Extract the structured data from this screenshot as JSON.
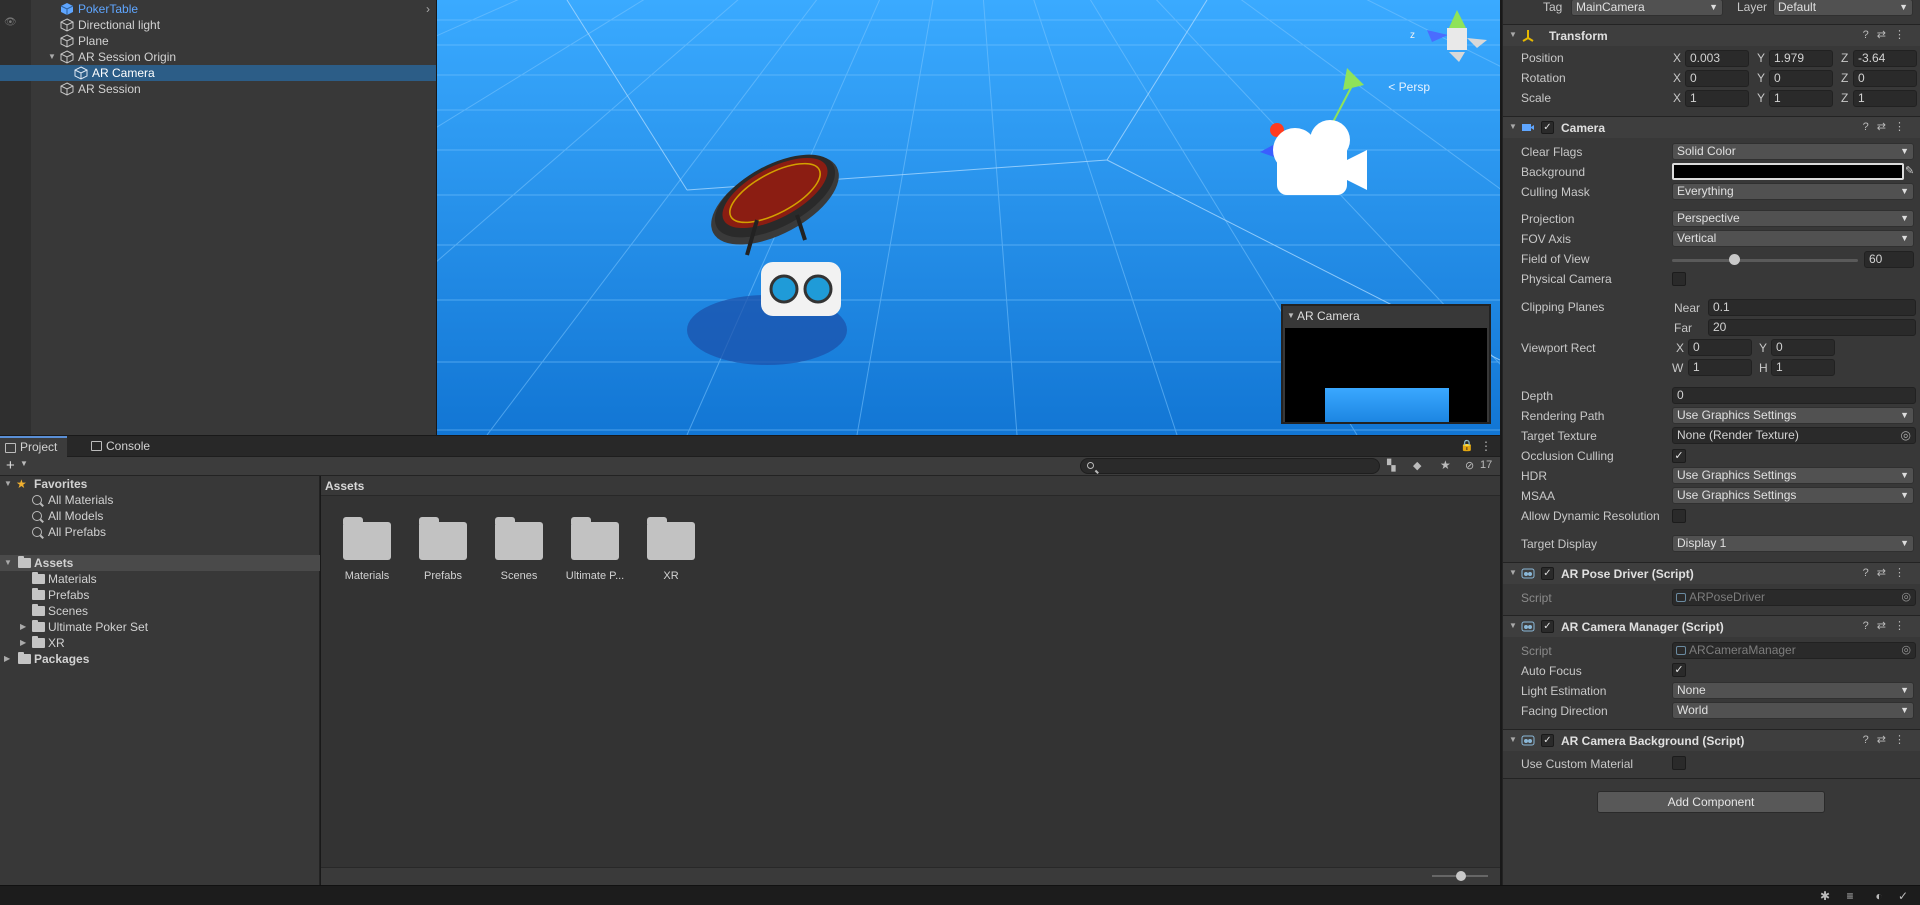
{
  "hierarchy": {
    "items": [
      {
        "label": "PokerTable",
        "prefab": true
      },
      {
        "label": "Directional light"
      },
      {
        "label": "Plane"
      },
      {
        "label": "AR Session Origin"
      },
      {
        "label": "AR Camera"
      },
      {
        "label": "AR Session"
      }
    ]
  },
  "scene": {
    "persp_label": "< Persp",
    "gizmo_z": "z",
    "camera_preview_title": "AR Camera"
  },
  "inspector": {
    "tag_label": "Tag",
    "tag_value": "MainCamera",
    "layer_label": "Layer",
    "layer_value": "Default",
    "transform": {
      "title": "Transform",
      "position_label": "Position",
      "rotation_label": "Rotation",
      "scale_label": "Scale",
      "position": {
        "x": "0.003",
        "y": "1.979",
        "z": "-3.64"
      },
      "rotation": {
        "x": "0",
        "y": "0",
        "z": "0"
      },
      "scale": {
        "x": "1",
        "y": "1",
        "z": "1"
      }
    },
    "camera": {
      "title": "Camera",
      "clear_flags_label": "Clear Flags",
      "clear_flags": "Solid Color",
      "background_label": "Background",
      "background_color": "#000000",
      "culling_mask_label": "Culling Mask",
      "culling_mask": "Everything",
      "projection_label": "Projection",
      "projection": "Perspective",
      "fov_axis_label": "FOV Axis",
      "fov_axis": "Vertical",
      "fov_label": "Field of View",
      "fov": "60",
      "physical_label": "Physical Camera",
      "clipping_label": "Clipping Planes",
      "near_label": "Near",
      "near": "0.1",
      "far_label": "Far",
      "far": "20",
      "viewport_label": "Viewport Rect",
      "vp_x": "0",
      "vp_y": "0",
      "vp_w": "1",
      "vp_h": "1",
      "depth_label": "Depth",
      "depth": "0",
      "rendering_path_label": "Rendering Path",
      "rendering_path": "Use Graphics Settings",
      "target_texture_label": "Target Texture",
      "target_texture": "None (Render Texture)",
      "occlusion_label": "Occlusion Culling",
      "hdr_label": "HDR",
      "hdr": "Use Graphics Settings",
      "msaa_label": "MSAA",
      "msaa": "Use Graphics Settings",
      "dynamic_res_label": "Allow Dynamic Resolution",
      "target_display_label": "Target Display",
      "target_display": "Display 1"
    },
    "pose_driver": {
      "title": "AR Pose Driver (Script)",
      "script_label": "Script",
      "script": "ARPoseDriver"
    },
    "camera_manager": {
      "title": "AR Camera Manager (Script)",
      "script_label": "Script",
      "script": "ARCameraManager",
      "auto_focus_label": "Auto Focus",
      "light_est_label": "Light Estimation",
      "light_est": "None",
      "facing_label": "Facing Direction",
      "facing": "World"
    },
    "camera_background": {
      "title": "AR Camera Background (Script)",
      "custom_mat_label": "Use Custom Material"
    },
    "add_component": "Add Component",
    "axis": {
      "x": "X",
      "y": "Y",
      "z": "Z",
      "w": "W",
      "h": "H"
    }
  },
  "project": {
    "tabs": [
      "Project",
      "Console"
    ],
    "hidden_count": "17",
    "favorites_label": "Favorites",
    "favorites": [
      "All Materials",
      "All Models",
      "All Prefabs"
    ],
    "assets_label": "Assets",
    "asset_folders": [
      "Materials",
      "Prefabs",
      "Scenes",
      "Ultimate Poker Set",
      "XR"
    ],
    "packages_label": "Packages",
    "breadcrumb": "Assets",
    "grid_items": [
      "Materials",
      "Prefabs",
      "Scenes",
      "Ultimate P...",
      "XR"
    ]
  },
  "colors": {
    "selection": "#2c5d87",
    "scene_sky": "#2a96f0",
    "prefab_text": "#5fa6ff"
  }
}
